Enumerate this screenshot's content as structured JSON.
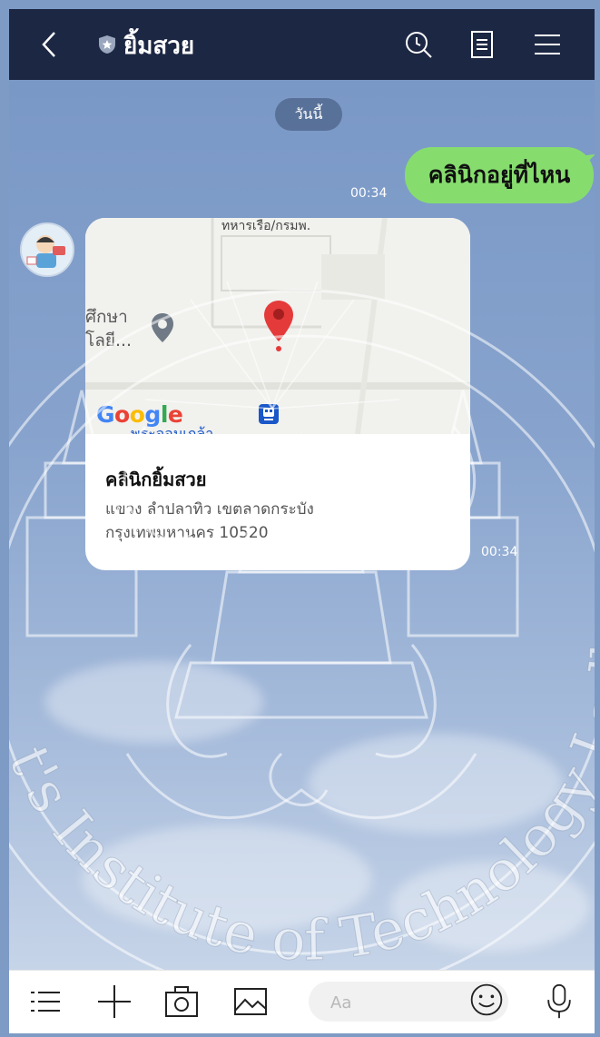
{
  "header": {
    "title": "ยิ้มสวย",
    "icons": [
      "back-icon",
      "shield-icon",
      "search-icon",
      "notes-icon",
      "menu-icon"
    ],
    "background": "#1c2743"
  },
  "chat": {
    "date_label": "วันนี้",
    "messages": [
      {
        "type": "outgoing",
        "text": "คลินิกอยู่ที่ไหน",
        "time": "00:34",
        "bubble_color": "#86dd6e"
      },
      {
        "type": "incoming-location",
        "time": "00:34",
        "map": {
          "partial_label": "ทหารเรือ/กรมพ.",
          "place_label": "ศึกษา โลยี...",
          "provider": "Google",
          "station_label": "พระจอมเกล้า"
        },
        "title": "คลินิกยิ้มสวย",
        "address_line1": "แขวง ลำปลาทิว เขตลาดกระบัง",
        "address_line2": "กรุงเทพมหานคร 10520"
      }
    ]
  },
  "composer": {
    "placeholder": "Aa",
    "icons": [
      "list-icon",
      "plus-icon",
      "camera-icon",
      "image-icon",
      "emoji-icon",
      "microphone-icon"
    ]
  },
  "watermark": {
    "text": "King Mongkut's Institute of Technology Ladkrabang",
    "visible_text": "t's Institute of Technology Ladkrabang"
  },
  "colors": {
    "chat_bg_top": "#7a98c6",
    "chat_bg_bottom": "#c6d4e8",
    "pin_red": "#e53a3a"
  }
}
